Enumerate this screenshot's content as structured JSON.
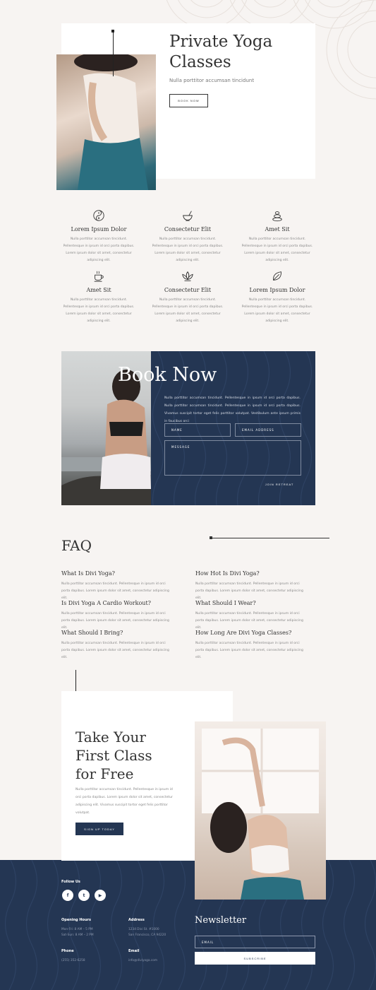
{
  "hero": {
    "title_line1": "Private Yoga",
    "title_line2": "Classes",
    "subtitle": "Nulla porttitor accumsan tincidunt",
    "button": "BOOK NOW"
  },
  "features": [
    {
      "icon": "yin-yang-icon",
      "title": "Lorem Ipsum Dolor",
      "text": "Nulla porttitor accumsan tincidunt. Pellentesque in ipsum id orci porta dapibus. Lorem ipsum dolor sit amet, consectetur adipiscing elit."
    },
    {
      "icon": "mortar-bowl-icon",
      "title": "Consectetur Elit",
      "text": "Nulla porttitor accumsan tincidunt. Pellentesque in ipsum id orci porta dapibus. Lorem ipsum dolor sit amet, consectetur adipiscing elit."
    },
    {
      "icon": "stacked-stones-icon",
      "title": "Amet Sit",
      "text": "Nulla porttitor accumsan tincidunt. Pellentesque in ipsum id orci porta dapibus. Lorem ipsum dolor sit amet, consectetur adipiscing elit."
    },
    {
      "icon": "tea-cup-icon",
      "title": "Amet Sit",
      "text": "Nulla porttitor accumsan tincidunt. Pellentesque in ipsum id orci porta dapibus. Lorem ipsum dolor sit amet, consectetur adipiscing elit."
    },
    {
      "icon": "lotus-icon",
      "title": "Consectetur Elit",
      "text": "Nulla porttitor accumsan tincidunt. Pellentesque in ipsum id orci porta dapibus. Lorem ipsum dolor sit amet, consectetur adipiscing elit."
    },
    {
      "icon": "leaf-icon",
      "title": "Lorem Ipsum Dolor",
      "text": "Nulla porttitor accumsan tincidunt. Pellentesque in ipsum id orci porta dapibus. Lorem ipsum dolor sit amet, consectetur adipiscing elit."
    }
  ],
  "book": {
    "title": "Book Now",
    "text": "Nulla porttitor accumsan tincidunt. Pellentesque in ipsum id orci porta dapibus. Nulla porttitor accumsan tincidunt. Pellentesque in ipsum id orci porta dapibus. Vivamus suscipit tortor eget felis porttitor volutpat. Vestibulum ante ipsum primis in faucibus orci",
    "name_placeholder": "NAME",
    "email_placeholder": "EMAIL ADDRESS",
    "message_placeholder": "MESSAGE",
    "button": "JOIN RETREAT"
  },
  "faq": {
    "title": "FAQ",
    "items": [
      {
        "q": "What Is Divi Yoga?",
        "a": "Nulla porttitor accumsan tincidunt. Pellentesque in ipsum id orci porta dapibus. Lorem ipsum dolor sit amet, consectetur adipiscing elit."
      },
      {
        "q": "How Hot Is Divi Yoga?",
        "a": "Nulla porttitor accumsan tincidunt. Pellentesque in ipsum id orci porta dapibus. Lorem ipsum dolor sit amet, consectetur adipiscing elit."
      },
      {
        "q": "Is Divi Yoga A Cardio Workout?",
        "a": "Nulla porttitor accumsan tincidunt. Pellentesque in ipsum id orci porta dapibus. Lorem ipsum dolor sit amet, consectetur adipiscing elit."
      },
      {
        "q": "What Should I Wear?",
        "a": "Nulla porttitor accumsan tincidunt. Pellentesque in ipsum id orci porta dapibus. Lorem ipsum dolor sit amet, consectetur adipiscing elit."
      },
      {
        "q": "What Should I Bring?",
        "a": "Nulla porttitor accumsan tincidunt. Pellentesque in ipsum id orci porta dapibus. Lorem ipsum dolor sit amet, consectetur adipiscing elit."
      },
      {
        "q": "How Long Are Divi Yoga Classes?",
        "a": "Nulla porttitor accumsan tincidunt. Pellentesque in ipsum id orci porta dapibus. Lorem ipsum dolor sit amet, consectetur adipiscing elit."
      }
    ]
  },
  "cta": {
    "title_line1": "Take Your",
    "title_line2": "First Class",
    "title_line3": "for Free",
    "text": "Nulla porttitor accumsan tincidunt. Pellentesque in ipsum id orci porta dapibus. Lorem ipsum dolor sit amet, consectetur adipiscing elit. Vivamus suscipit tortor eget felis porttitor volutpat.",
    "button": "SIGN UP TODAY"
  },
  "footer": {
    "follow_label": "Follow Us",
    "social": [
      "f",
      "t",
      "▶"
    ],
    "hours_label": "Opening Hours",
    "hours_line1": "Mon-Fri: 8 AM – 5 PM",
    "hours_line2": "Sat-Sun: 8 AM – 2 PM",
    "address_label": "Address",
    "address_line1": "1234 Divi St. #1000",
    "address_line2": "San Francisco, CA 94220",
    "phone_label": "Phone",
    "phone": "(255) 352-6258",
    "email_label": "Email",
    "email": "info@diviyoga.com",
    "newsletter_title": "Newsletter",
    "newsletter_placeholder": "EMAIL",
    "newsletter_button": "SUBSCRIBE"
  },
  "colors": {
    "navy": "#243653",
    "background": "#f7f4f2",
    "card": "#ffffff"
  }
}
